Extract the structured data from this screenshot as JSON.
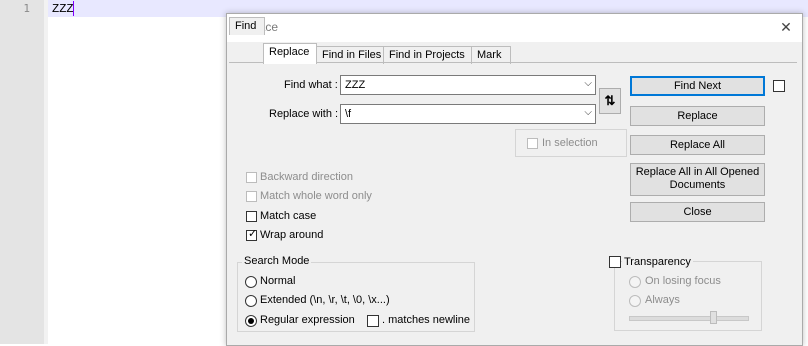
{
  "editor": {
    "line_number": "1",
    "text": "ZZZ"
  },
  "dialog": {
    "title": "Replace",
    "tabs": [
      {
        "label": "Find"
      },
      {
        "label": "Replace"
      },
      {
        "label": "Find in Files"
      },
      {
        "label": "Find in Projects"
      },
      {
        "label": "Mark"
      }
    ],
    "active_tab": "Replace",
    "find_label": "Find what :",
    "find_value": "ZZZ",
    "replace_label": "Replace with :",
    "replace_value": "\\f",
    "in_selection_label": "In selection",
    "buttons": {
      "find_next": "Find Next",
      "replace": "Replace",
      "replace_all": "Replace All",
      "replace_all_opened_line1": "Replace All in All Opened",
      "replace_all_opened_line2": "Documents",
      "close": "Close"
    },
    "options": {
      "backward": "Backward direction",
      "whole_word": "Match whole word only",
      "match_case": "Match case",
      "wrap_around": "Wrap around"
    },
    "search_mode": {
      "title": "Search Mode",
      "normal": "Normal",
      "extended": "Extended (\\n, \\r, \\t, \\0, \\x...)",
      "regex": "Regular expression",
      "matches_newline": ". matches newline"
    },
    "transparency": {
      "title": "Transparency",
      "on_losing_focus": "On losing focus",
      "always": "Always"
    }
  }
}
